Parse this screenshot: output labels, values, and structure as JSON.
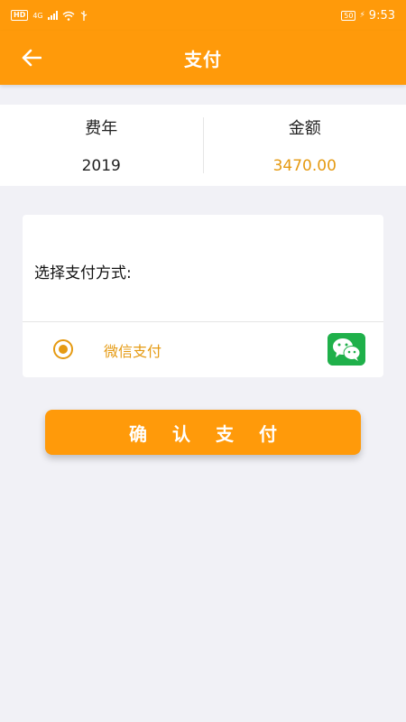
{
  "status_bar": {
    "badge": "HD",
    "network": "4G",
    "battery": "50",
    "time": "9:53"
  },
  "header": {
    "title": "支付",
    "back_icon": "arrow-left-icon"
  },
  "summary": {
    "year_label": "费年",
    "year_value": "2019",
    "amount_label": "金额",
    "amount_value": "3470.00"
  },
  "payment": {
    "title": "选择支付方式:",
    "method_label": "微信支付",
    "method_icon": "wechat-icon",
    "selected": true
  },
  "actions": {
    "confirm_label": "确认支付"
  },
  "colors": {
    "primary": "#ff9a0a",
    "accent_text": "#e59a12",
    "wechat_green": "#1fb04a",
    "background": "#f1f1f6"
  }
}
